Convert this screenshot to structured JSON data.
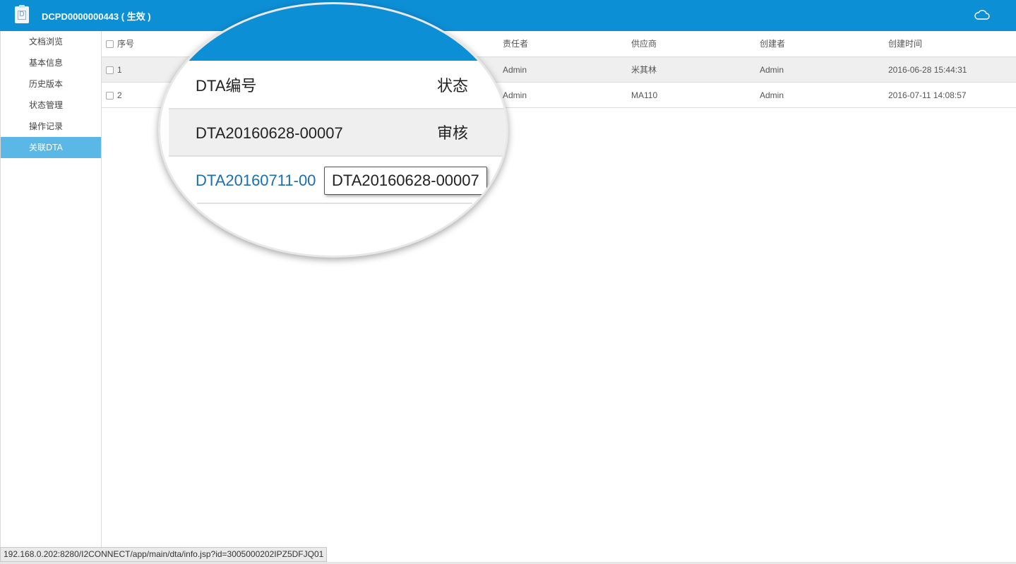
{
  "header": {
    "title": "DCPD0000000443 ( 生效 )",
    "doc_icon_letter": "D",
    "accent_color": "#0d8fd6"
  },
  "sidebar": {
    "items": [
      {
        "label": "文档浏览"
      },
      {
        "label": "基本信息"
      },
      {
        "label": "历史版本"
      },
      {
        "label": "状态管理"
      },
      {
        "label": "操作记录"
      },
      {
        "label": "关联DTA",
        "active": true
      }
    ],
    "active_color": "#5bb8e6"
  },
  "table": {
    "columns": [
      "序号",
      "DTA编号",
      "状态",
      "责任者",
      "供应商",
      "创建者",
      "创建时间"
    ],
    "rows": [
      {
        "index": "1",
        "dta": "DTA20160628-00007",
        "status": "审核",
        "owner": "Admin",
        "supplier": "米其林",
        "creator": "Admin",
        "created": "2016-06-28 15:44:31"
      },
      {
        "index": "2",
        "dta": "DTA20160711-00",
        "status": "",
        "owner": "Admin",
        "supplier": "MA110",
        "creator": "Admin",
        "created": "2016-07-11 14:08:57"
      }
    ]
  },
  "magnifier": {
    "header_dta": "DTA编号",
    "header_status": "状态",
    "row1_dta": "DTA20160628-00007",
    "row1_status": "审核",
    "row2_dta": "DTA20160711-00",
    "tooltip": "DTA20160628-00007"
  },
  "statusbar": {
    "url": "192.168.0.202:8280/I2CONNECT/app/main/dta/info.jsp?id=3005000202IPZ5DFJQ01"
  },
  "icons": {
    "doc": "document-icon",
    "cloud": "cloud-icon",
    "checkbox": "checkbox"
  }
}
